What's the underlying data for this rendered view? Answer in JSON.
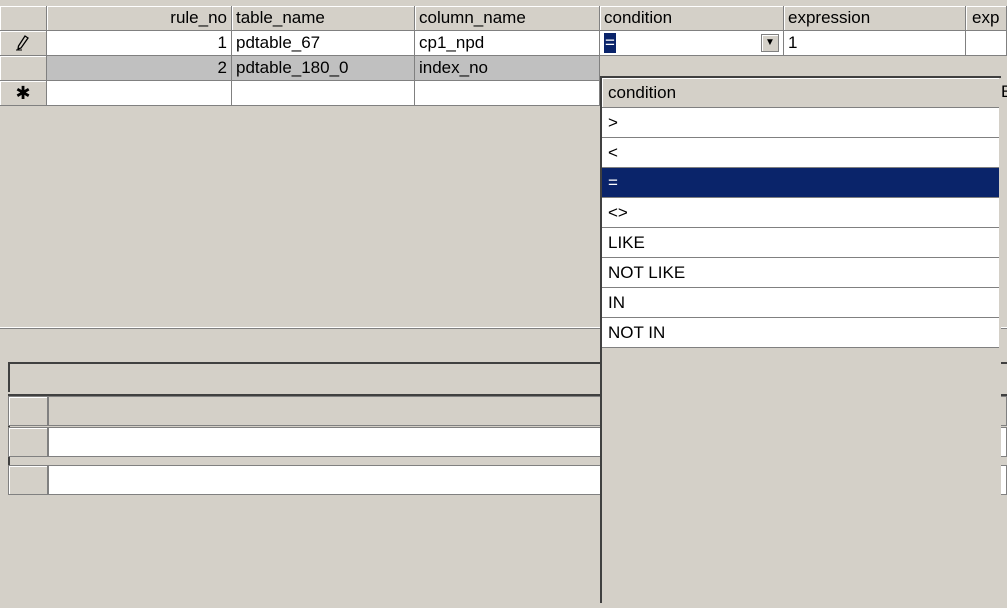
{
  "grid": {
    "columns": [
      "rule_no",
      "table_name",
      "column_name",
      "condition",
      "expression",
      "exp"
    ],
    "rows": [
      {
        "rule_no": "1",
        "table_name": "pdtable_67",
        "column_name": "cp1_npd",
        "condition": "=",
        "expression": "1"
      },
      {
        "rule_no": "2",
        "table_name": "pdtable_180_0",
        "column_name": "index_no",
        "condition": "",
        "expression": ""
      }
    ],
    "row_selectors": {
      "editing": "pencil-icon",
      "new": "asterisk-icon"
    },
    "editing_glyph": "𝒪",
    "new_glyph": "✱"
  },
  "dropdown": {
    "header": "condition",
    "options": [
      ">",
      "<",
      "=",
      "<>",
      "LIKE",
      "NOT LIKE",
      "IN",
      "NOT IN"
    ],
    "selected": "=",
    "peek_text": "E"
  },
  "colors": {
    "selection": "#0a246a",
    "face": "#d4d0c8",
    "selected_row": "#c0c0c0"
  }
}
